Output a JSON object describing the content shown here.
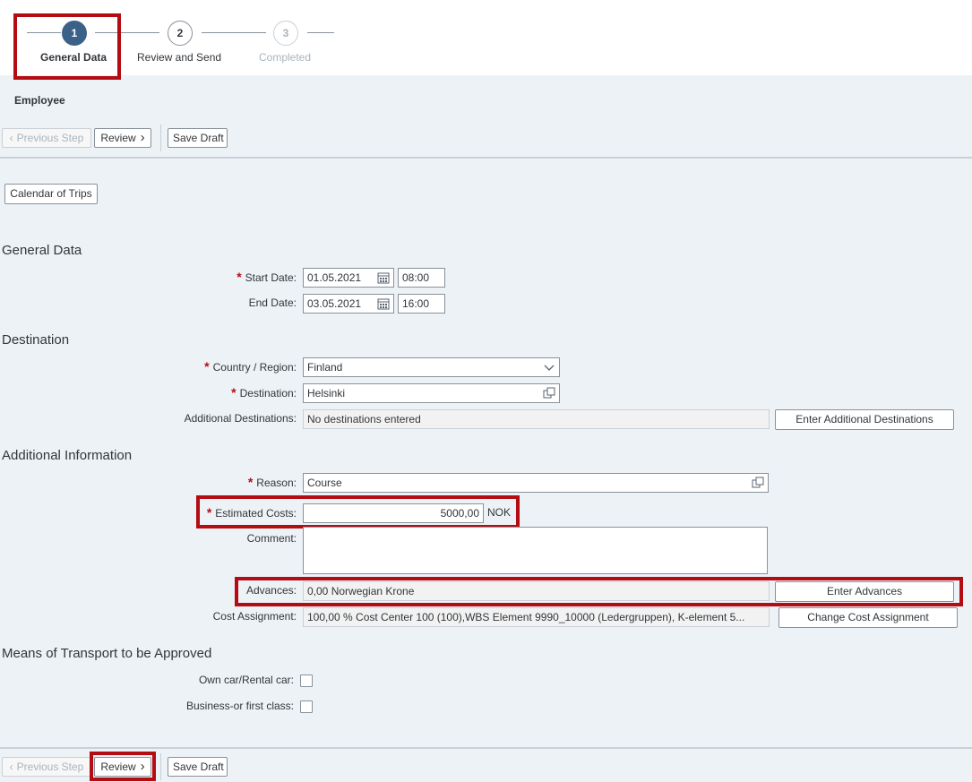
{
  "roadmap": {
    "steps": [
      {
        "number": "1",
        "label": "General Data"
      },
      {
        "number": "2",
        "label": "Review and Send"
      },
      {
        "number": "3",
        "label": "Completed"
      }
    ]
  },
  "header": {
    "employee_label": "Employee"
  },
  "toolbar": {
    "previous_label": "Previous Step",
    "review_label": "Review",
    "save_draft_label": "Save Draft"
  },
  "calendar_button_label": "Calendar of Trips",
  "general_data": {
    "title": "General Data",
    "start_date_label": "Start Date:",
    "start_date": "01.05.2021",
    "start_time": "08:00",
    "end_date_label": "End Date:",
    "end_date": "03.05.2021",
    "end_time": "16:00"
  },
  "destination": {
    "title": "Destination",
    "country_label": "Country / Region:",
    "country_value": "Finland",
    "destination_label": "Destination:",
    "destination_value": "Helsinki",
    "additional_label": "Additional Destinations:",
    "additional_value": "No destinations entered",
    "additional_button": "Enter Additional Destinations"
  },
  "additional_info": {
    "title": "Additional Information",
    "reason_label": "Reason:",
    "reason_value": "Course",
    "costs_label": "Estimated Costs:",
    "costs_value": "5000,00",
    "costs_currency": "NOK",
    "comment_label": "Comment:",
    "comment_value": "",
    "advances_label": "Advances:",
    "advances_value": "0,00 Norwegian Krone",
    "advances_button": "Enter Advances",
    "cost_assignment_label": "Cost Assignment:",
    "cost_assignment_value": "100,00 % Cost Center 100 (100),WBS Element 9990_10000 (Ledergruppen), K-element 5...",
    "cost_assignment_button": "Change Cost Assignment"
  },
  "transport": {
    "title": "Means of Transport to be Approved",
    "own_car_label": "Own car/Rental car:",
    "own_car_checked": false,
    "business_label": "Business-or first class:",
    "business_checked": false
  },
  "colors": {
    "accent": "#3c6189",
    "required": "#b30d13",
    "highlight": "#b30d13"
  }
}
